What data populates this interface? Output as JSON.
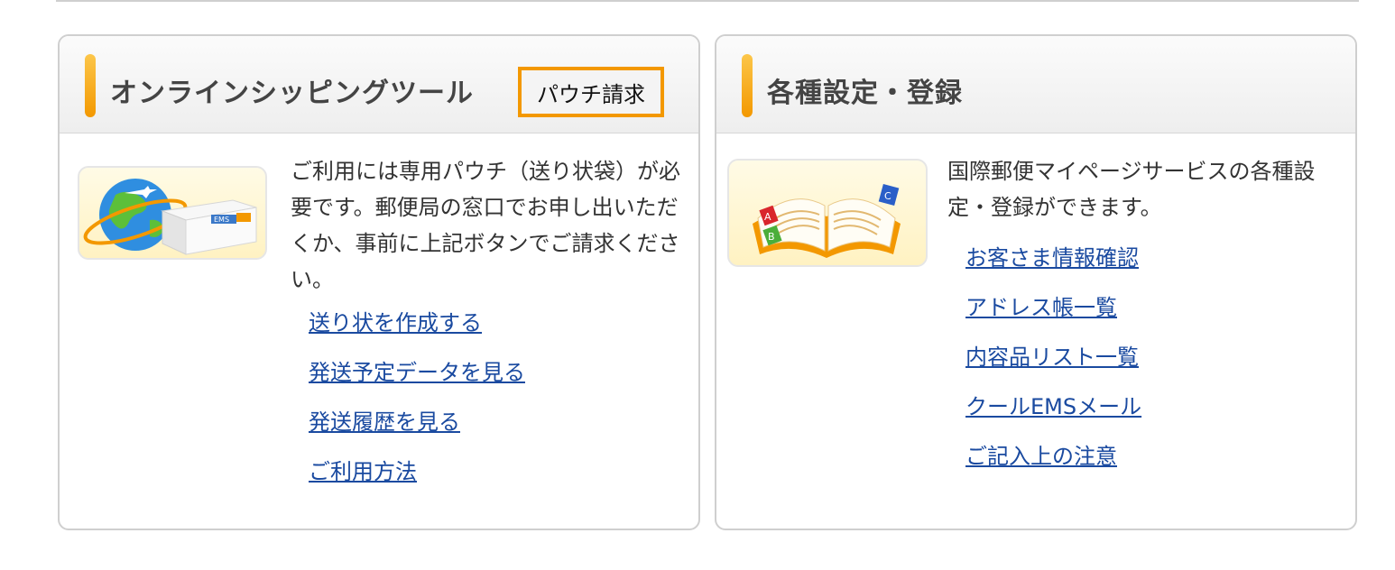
{
  "shipping_panel": {
    "title": "オンラインシッピングツール",
    "pouch_button": "パウチ請求",
    "description": "ご利用には専用パウチ（送り状袋）が必要です。郵便局の窓口でお申し出いただくか、事前に上記ボタンでご請求ください。",
    "image_label": "EMS",
    "links": [
      {
        "label": "送り状を作成する"
      },
      {
        "label": "発送予定データを見る"
      },
      {
        "label": "発送履歴を見る"
      },
      {
        "label": "ご利用方法"
      }
    ]
  },
  "settings_panel": {
    "title": "各種設定・登録",
    "description": "国際郵便マイページサービスの各種設定・登録ができます。",
    "book_letters": [
      "A",
      "B",
      "C"
    ],
    "links": [
      {
        "label": "お客さま情報確認"
      },
      {
        "label": "アドレス帳一覧"
      },
      {
        "label": "内容品リスト一覧"
      },
      {
        "label": "クールEMSメール"
      },
      {
        "label": "ご記入上の注意"
      }
    ]
  },
  "colors": {
    "accent": "#f39800",
    "link": "#1a4aa0",
    "border": "#cfcfcf"
  }
}
